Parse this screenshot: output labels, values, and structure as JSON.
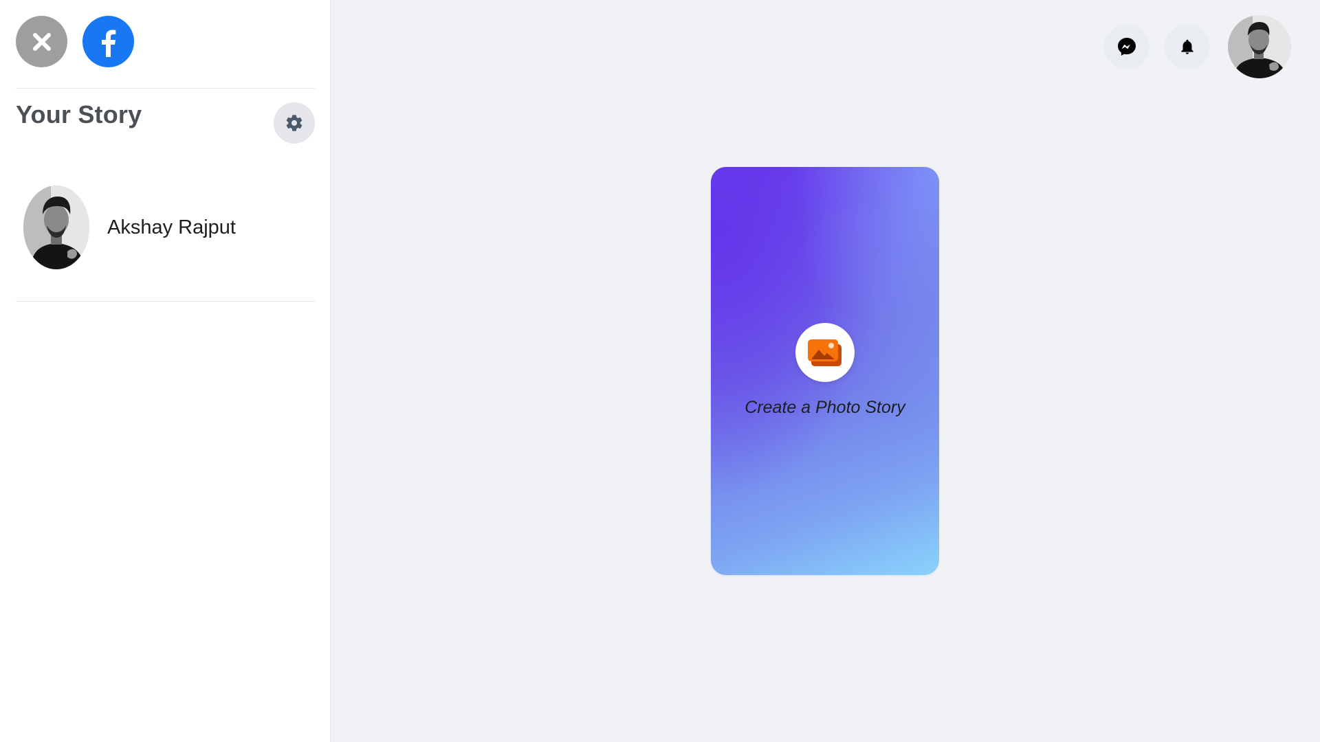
{
  "sidebar": {
    "close_icon": "close-icon",
    "logo_icon": "facebook-logo-icon",
    "title": "Your Story",
    "settings_icon": "gear-icon",
    "profile": {
      "name": "Akshay Rajput",
      "avatar": "avatar"
    }
  },
  "topbar": {
    "messenger_icon": "messenger-icon",
    "notifications_icon": "bell-icon",
    "account_avatar": "avatar"
  },
  "main": {
    "photo_story": {
      "label": "Create a Photo Story",
      "icon": "photo-icon"
    }
  },
  "colors": {
    "page_background": "#f0f2f5",
    "sidebar_background": "#ffffff",
    "facebook_blue": "#1877f2",
    "close_grey": "#9e9e9e",
    "card_gradient_start": "#6436ea",
    "card_gradient_end": "#8ad3fc",
    "photo_icon_orange": "#f7720a"
  }
}
